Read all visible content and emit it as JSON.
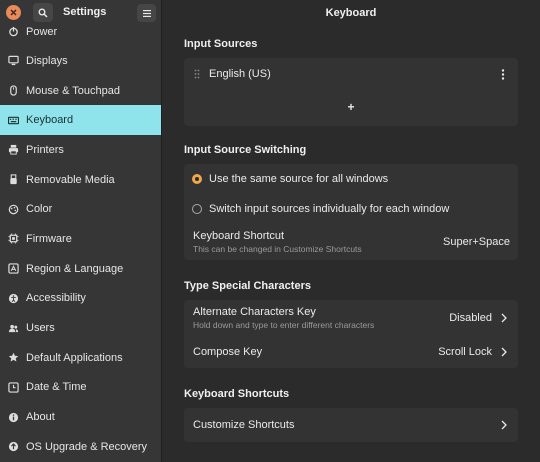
{
  "app": {
    "title": "Settings"
  },
  "window": {
    "title": "Keyboard"
  },
  "sidebar": {
    "items": [
      {
        "label": "Power",
        "icon": "power-icon"
      },
      {
        "label": "Displays",
        "icon": "display-icon"
      },
      {
        "label": "Mouse & Touchpad",
        "icon": "mouse-icon"
      },
      {
        "label": "Keyboard",
        "icon": "keyboard-icon",
        "active": true
      },
      {
        "label": "Printers",
        "icon": "printer-icon"
      },
      {
        "label": "Removable Media",
        "icon": "usb-icon"
      },
      {
        "label": "Color",
        "icon": "palette-icon"
      },
      {
        "label": "Firmware",
        "icon": "chip-icon"
      },
      {
        "label": "Region & Language",
        "icon": "globe-icon"
      },
      {
        "label": "Accessibility",
        "icon": "accessibility-icon"
      },
      {
        "label": "Users",
        "icon": "users-icon"
      },
      {
        "label": "Default Applications",
        "icon": "star-icon"
      },
      {
        "label": "Date & Time",
        "icon": "clock-icon"
      },
      {
        "label": "About",
        "icon": "info-icon"
      },
      {
        "label": "OS Upgrade & Recovery",
        "icon": "upgrade-icon"
      }
    ]
  },
  "input_sources": {
    "title": "Input Sources",
    "source": "English (US)",
    "add_label": "+"
  },
  "switching": {
    "title": "Input Source Switching",
    "option_same": "Use the same source for all windows",
    "option_individual": "Switch input sources individually for each window",
    "shortcut_label": "Keyboard Shortcut",
    "shortcut_sub": "This can be changed in Customize Shortcuts",
    "shortcut_value": "Super+Space"
  },
  "special": {
    "title": "Type Special Characters",
    "alt_label": "Alternate Characters Key",
    "alt_sub": "Hold down and type to enter different characters",
    "alt_value": "Disabled",
    "compose_label": "Compose Key",
    "compose_value": "Scroll Lock"
  },
  "shortcuts": {
    "title": "Keyboard Shortcuts",
    "customize_label": "Customize Shortcuts"
  },
  "colors": {
    "accent": "#8ee4ea",
    "radio_on": "#f0a84a",
    "close": "#e88a59"
  }
}
